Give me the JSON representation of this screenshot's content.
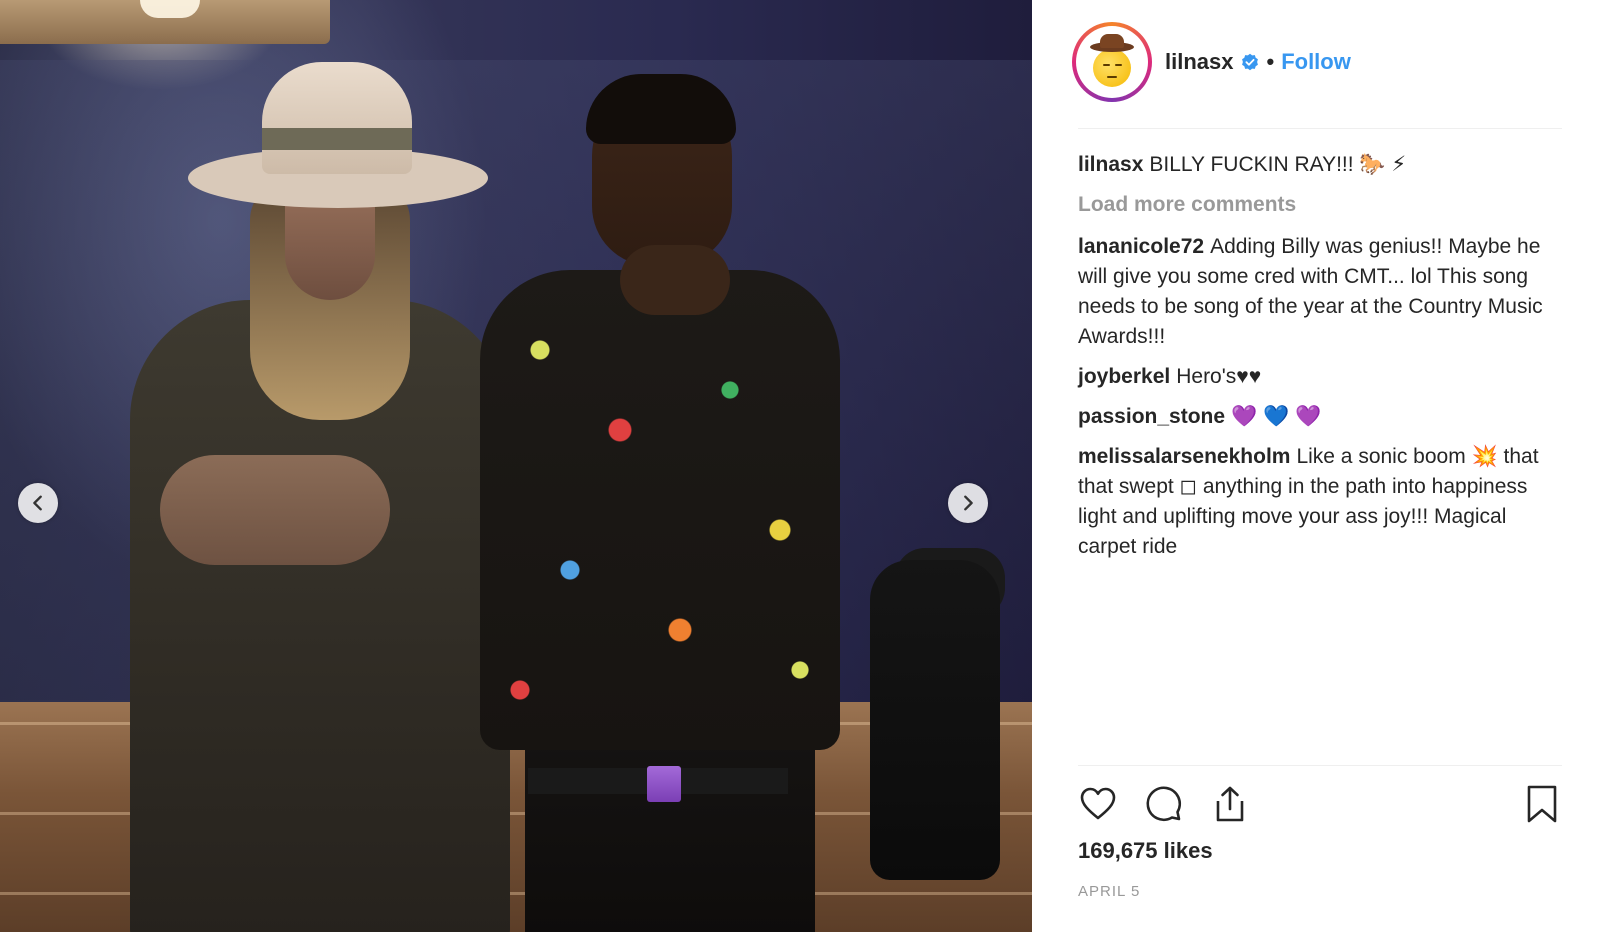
{
  "post": {
    "username": "lilnasx",
    "follow_label": "Follow",
    "separator": "•",
    "caption": {
      "user": "lilnasx",
      "text": "BILLY FUCKIN RAY!!! 🐎 ⚡"
    },
    "load_more_label": "Load more comments",
    "comments": [
      {
        "user": "lananicole72",
        "text": "Adding Billy was genius!! Maybe he will give you some cred with CMT... lol This song needs to be song of the year at the Country Music Awards!!!"
      },
      {
        "user": "joyberkel",
        "text": "Hero's♥♥"
      },
      {
        "user": "passion_stone",
        "text": "💜 💙 💜"
      },
      {
        "user": "melissalarsenekholm",
        "text": "Like a sonic boom 💥 that that swept ◻ anything in the path into happiness light and uplifting move your ass joy!!! Magical carpet ride"
      }
    ],
    "likes_label": "169,675 likes",
    "date_label": "APRIL 5"
  },
  "icons": {
    "like": "heart-icon",
    "comment": "comment-bubble-icon",
    "share": "share-icon",
    "save": "bookmark-icon",
    "verified": "verified-badge-icon",
    "prev": "chevron-left-icon",
    "next": "chevron-right-icon"
  },
  "colors": {
    "accent": "#3897f0",
    "text": "#262626",
    "muted": "#999999",
    "divider": "#efefef"
  }
}
